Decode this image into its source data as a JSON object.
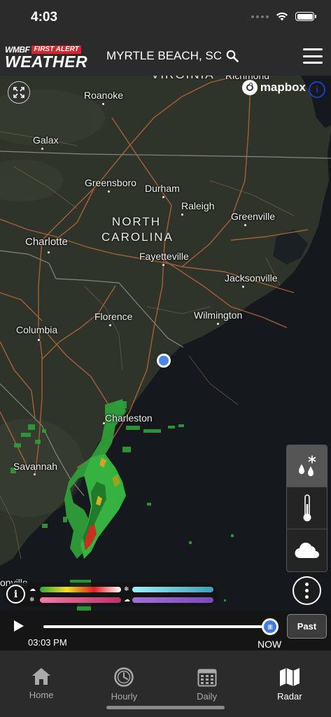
{
  "status_bar": {
    "time": "4:03"
  },
  "header": {
    "logo_station": "WMBF",
    "logo_first_alert": "FIRST ALERT",
    "logo_weather": "WEATHER",
    "location": "MYRTLE BEACH, SC"
  },
  "map": {
    "attribution": "mapbox",
    "state_labels": {
      "virginia": "VIRGINIA",
      "north_carolina_line1": "NORTH",
      "north_carolina_line2": "CAROLINA"
    },
    "cities": {
      "richmond": "Richmond",
      "roanoke": "Roanoke",
      "galax": "Galax",
      "greensboro": "Greensboro",
      "durham": "Durham",
      "raleigh": "Raleigh",
      "greenville": "Greenville",
      "charlotte": "Charlotte",
      "fayetteville": "Fayetteville",
      "jacksonville": "Jacksonville",
      "wilmington": "Wilmington",
      "florence": "Florence",
      "columbia": "Columbia",
      "charleston": "Charleston",
      "savannah": "Savannah",
      "jacksonville_fl": "onville"
    }
  },
  "layers": [
    {
      "name": "precipitation",
      "icon": "rain-snow-icon",
      "active": true
    },
    {
      "name": "temperature",
      "icon": "thermometer-icon",
      "active": false
    },
    {
      "name": "clouds",
      "icon": "cloud-icon",
      "active": false
    }
  ],
  "legend": {
    "rain_colors": [
      "#2fa83a",
      "#f0e020",
      "#e02020",
      "#ffffff"
    ],
    "snow_colors": [
      "#9bf0ff",
      "#3aa0b8"
    ],
    "mix_colors": [
      "#f07aa8",
      "#c0306a"
    ],
    "ice_colors": [
      "#a070d8",
      "#7a4ac0"
    ]
  },
  "timeline": {
    "time": "03:03 PM",
    "now_label": "NOW",
    "past_button": "Past",
    "progress": 1.0
  },
  "tabs": [
    {
      "label": "Home",
      "icon": "home-icon",
      "active": false
    },
    {
      "label": "Hourly",
      "icon": "clock-icon",
      "active": false
    },
    {
      "label": "Daily",
      "icon": "calendar-icon",
      "active": false
    },
    {
      "label": "Radar",
      "icon": "map-icon",
      "active": true
    }
  ]
}
